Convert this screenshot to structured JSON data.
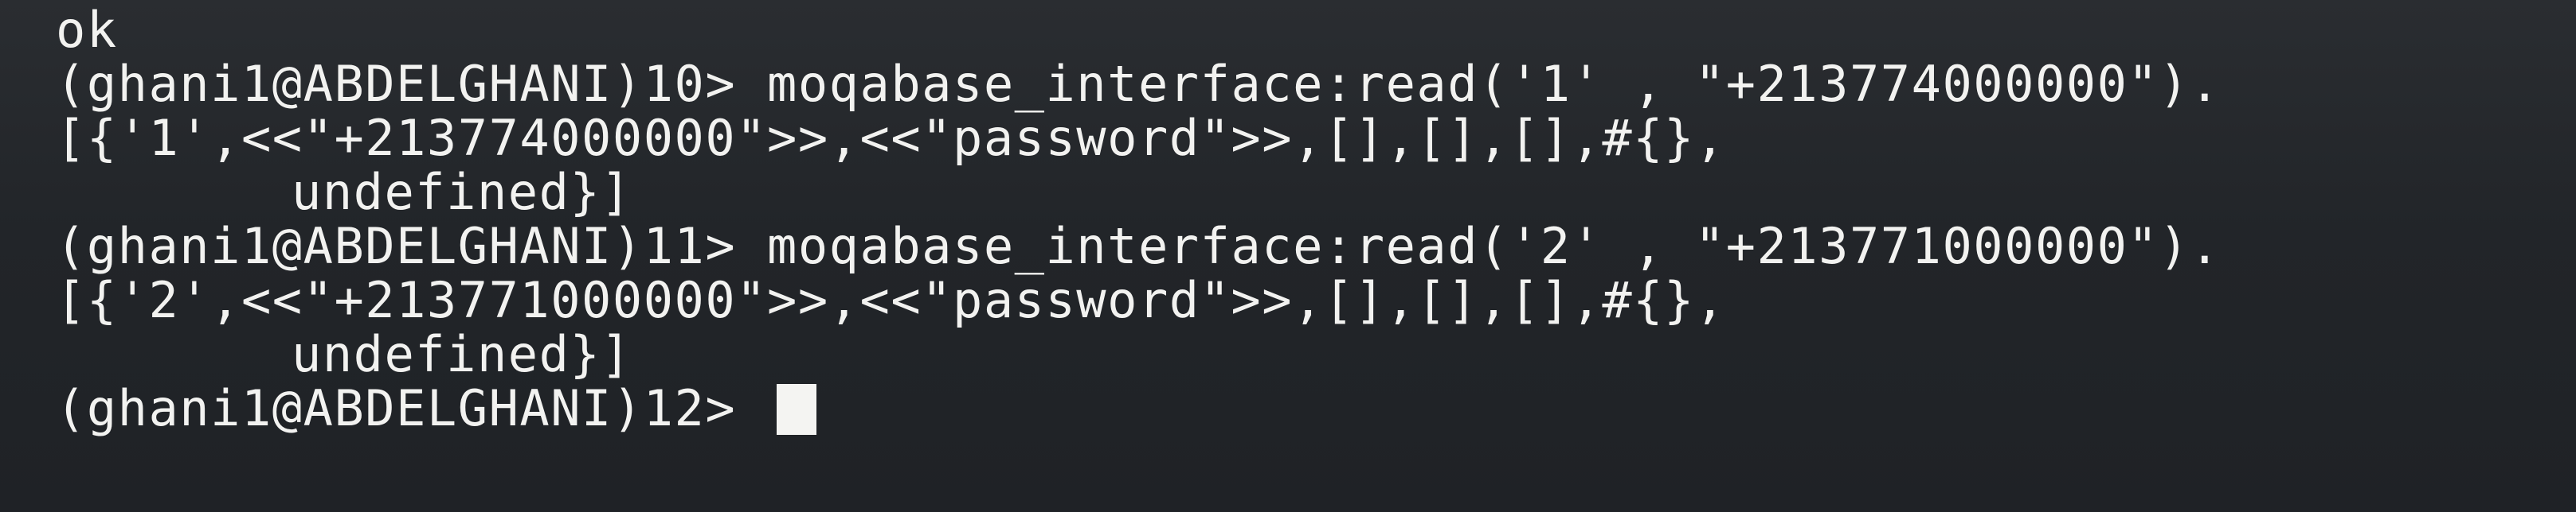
{
  "terminal": {
    "lines": [
      {
        "text": "ok"
      },
      {
        "prompt": "(ghani1@ABDELGHANI)10> ",
        "command": "moqabase_interface:read('1' , \"+213774000000\")."
      },
      {
        "text": "[{'1',<<\"+213774000000\">>,<<\"password\">>,[],[],[],#{},"
      },
      {
        "text": "undefined}]"
      },
      {
        "prompt": "(ghani1@ABDELGHANI)11> ",
        "command": "moqabase_interface:read('2' , \"+213771000000\")."
      },
      {
        "text": "[{'2',<<\"+213771000000\">>,<<\"password\">>,[],[],[],#{},"
      },
      {
        "text": "undefined}]"
      },
      {
        "prompt": "(ghani1@ABDELGHANI)12> "
      }
    ]
  },
  "colors": {
    "background": "#24272b",
    "text": "#f2f2f0",
    "cursor": "#f4f4f2"
  }
}
